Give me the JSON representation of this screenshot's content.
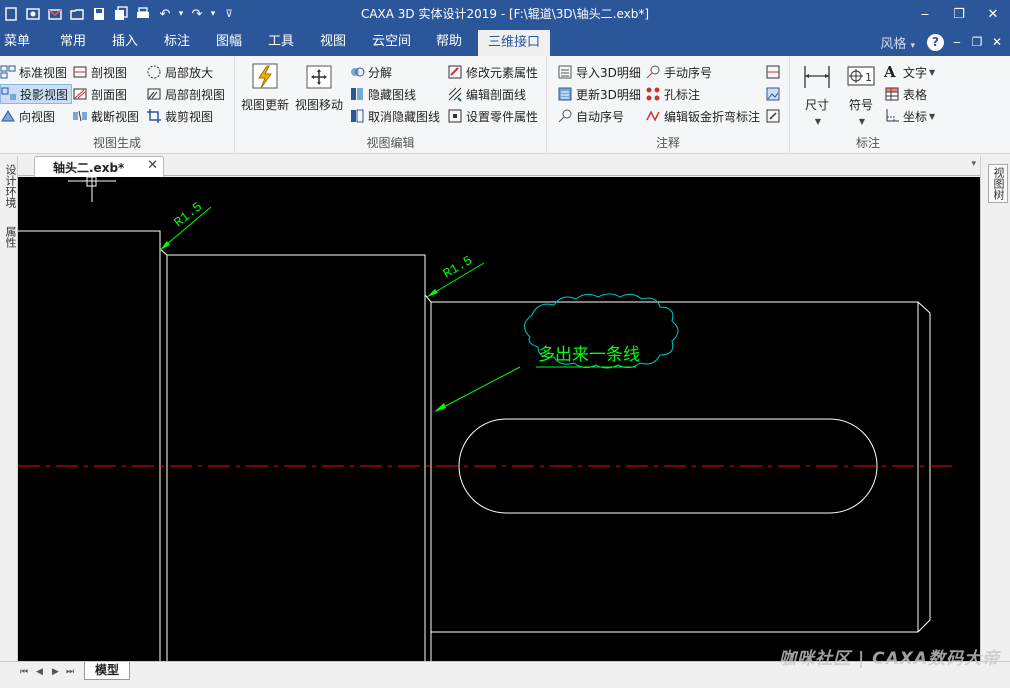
{
  "window": {
    "title": "CAXA 3D 实体设计2019 - [F:\\辊道\\3D\\轴头二.exb*]",
    "controls": {
      "minimize": "‒",
      "restore": "❐",
      "close": "✕"
    }
  },
  "qat": {
    "icons": [
      "new-doc-icon",
      "open-icon",
      "mail-icon",
      "folder-icon",
      "save-icon",
      "save-all-icon",
      "print-icon",
      "undo-icon",
      "redo-icon",
      "customize-icon"
    ],
    "undo": "↶",
    "redo": "↷",
    "more": "▾",
    "customize": "⊽"
  },
  "tabs": [
    "菜单",
    "常用",
    "插入",
    "标注",
    "图幅",
    "工具",
    "视图",
    "云空间",
    "帮助",
    "三维接口"
  ],
  "active_tab": "三维接口",
  "tabbar_right": {
    "style_label": "风格",
    "dropdown": "▾",
    "help": "?",
    "minimize": "‒",
    "restore": "❐",
    "close": "✕"
  },
  "ribbon": {
    "view_gen": {
      "title": "视图生成",
      "items": [
        "标准视图",
        "投影视图",
        "向视图",
        "剖视图",
        "剖面图",
        "截断视图",
        "局部放大",
        "局部剖视图",
        "裁剪视图"
      ]
    },
    "view_edit": {
      "title": "视图编辑",
      "big": [
        "视图更新",
        "视图移动"
      ],
      "items": [
        "分解",
        "隐藏图线",
        "取消隐藏图线",
        "修改元素属性",
        "编辑剖面线",
        "设置零件属性"
      ]
    },
    "annotation": {
      "title": "注释",
      "items": [
        "导入3D明细",
        "更新3D明细",
        "自动序号",
        "手动序号",
        "孔标注",
        "编辑钣金折弯标注"
      ]
    },
    "dimension": {
      "title": "标注",
      "big": [
        "尺寸",
        "符号"
      ],
      "items": [
        "文字",
        "表格",
        "坐标"
      ]
    }
  },
  "document": {
    "tab": "轴头二.exb*",
    "close": "✕",
    "more": "▾"
  },
  "panels": {
    "left": [
      "设计环境",
      "属性"
    ],
    "right": [
      "视图树"
    ]
  },
  "drawing": {
    "annotations": [
      "R1.5",
      "R1.5"
    ],
    "note": "多出来一条线",
    "colors": {
      "background": "#000000",
      "outline": "#ffffff",
      "dimension": "#00ff00",
      "cloud": "#00c8c8",
      "centerline": "#ff0000"
    }
  },
  "bottom": {
    "nav": [
      "⏮",
      "◀",
      "▶",
      "⏭"
    ],
    "model_tab": "模型",
    "watermark": "咖咪社区 | CAXA数码大帝"
  }
}
